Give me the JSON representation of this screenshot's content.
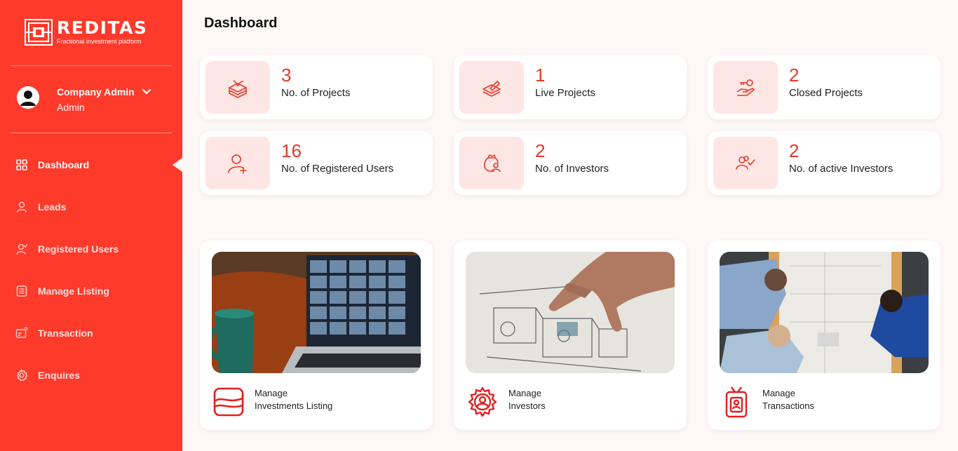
{
  "brand": {
    "name": "REDITAS",
    "tagline": "Fractional investment platform"
  },
  "user": {
    "name": "Company Admin",
    "role": "Admin"
  },
  "nav": [
    {
      "label": "Dashboard",
      "icon": "grid-icon"
    },
    {
      "label": "Leads",
      "icon": "person-icon"
    },
    {
      "label": "Registered Users",
      "icon": "user-check-icon"
    },
    {
      "label": "Manage Listing",
      "icon": "list-icon"
    },
    {
      "label": "Transaction",
      "icon": "transaction-icon"
    },
    {
      "label": "Enquires",
      "icon": "gear-icon"
    }
  ],
  "page": {
    "title": "Dashboard"
  },
  "stats": [
    {
      "value": "3",
      "label": "No. of Projects",
      "icon": "stacked-box-icon"
    },
    {
      "value": "1",
      "label": "Live Projects",
      "icon": "layers-icon"
    },
    {
      "value": "2",
      "label": "Closed Projects",
      "icon": "hand-key-icon"
    },
    {
      "value": "16",
      "label": "No. of Registered Users",
      "icon": "user-plus-icon"
    },
    {
      "value": "2",
      "label": "No. of Investors",
      "icon": "money-bag-icon"
    },
    {
      "value": "2",
      "label": "No. of active Investors",
      "icon": "users-check-icon"
    }
  ],
  "cards": [
    {
      "line1": "Manage",
      "line2": "Investments Listing",
      "icon": "image-frame-icon"
    },
    {
      "line1": "Manage",
      "line2": "Investors",
      "icon": "gear-user-icon"
    },
    {
      "line1": "Manage",
      "line2": "Transactions",
      "icon": "id-badge-icon"
    }
  ],
  "colors": {
    "primary": "#fe3a2a",
    "accent": "#e53a2a",
    "icon_bg": "#fde6e4",
    "background": "#fdf8f7"
  }
}
